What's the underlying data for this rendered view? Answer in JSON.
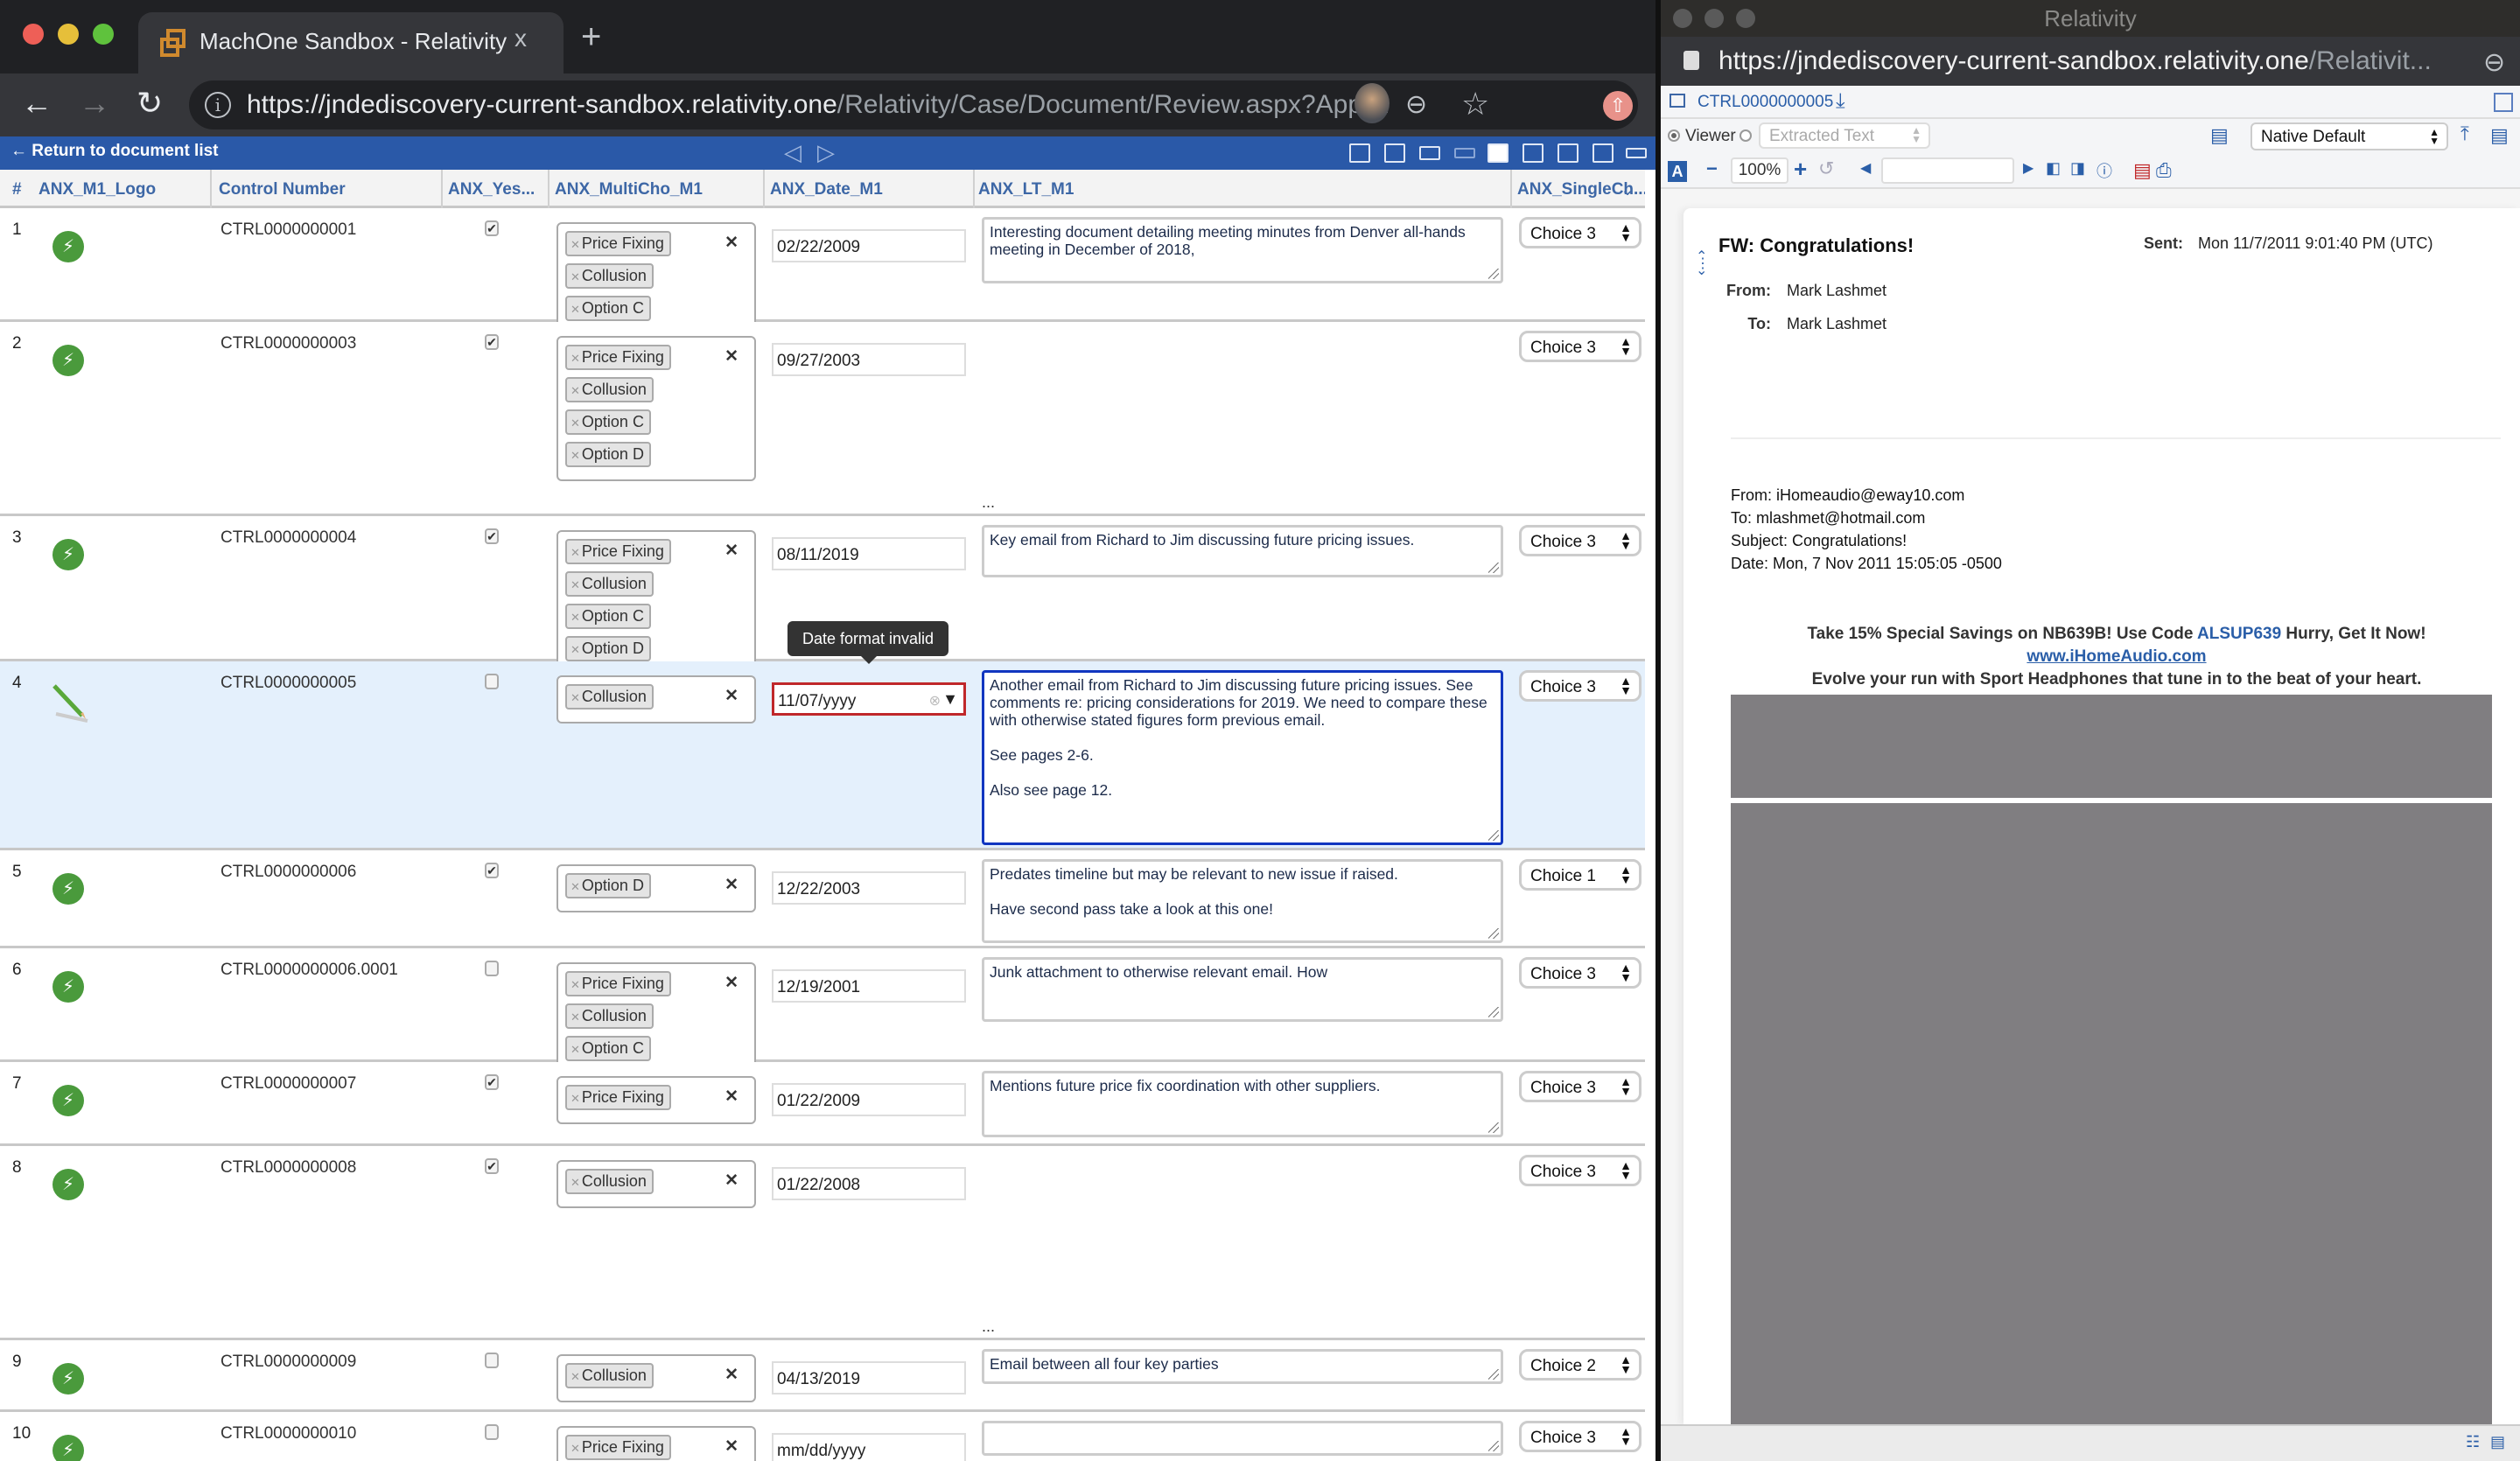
{
  "browser": {
    "tab_title": "MachOne Sandbox - Relativity",
    "tab_close": "x",
    "new_tab": "+",
    "url_host": "https://jndediscovery-current-sandbox.relativity.one",
    "url_path": "/Relativity/Case/Document/Review.aspx?Appl...",
    "back": "←",
    "forward": "→",
    "reload": "↻"
  },
  "review_bar": {
    "return_label": "← Return to document list",
    "prev": "◁",
    "next": "▷",
    "icons": [
      "print-icon",
      "print-alt-icon",
      "keyboard-info-icon",
      "keyboard-icon",
      "grid-layout-icon",
      "popout-icon",
      "panel-layout-icon",
      "window-settings-icon",
      "collapse-icon"
    ]
  },
  "grid": {
    "columns": [
      "#",
      "ANX_M1_Logo",
      "Control Number",
      "ANX_Yes...",
      "ANX_MultiCho_M1",
      "ANX_Date_M1",
      "ANX_LT_M1",
      "ANX_SingleCh..."
    ],
    "tooltip": "Date format invalid",
    "rows": [
      {
        "n": "1",
        "logo": "bolt",
        "control": "CTRL0000000001",
        "checked": true,
        "multi": [
          "Price Fixing",
          "Collusion",
          "Option C"
        ],
        "date": "02/22/2009",
        "text": "Interesting document detailing meeting minutes from Denver all-hands meeting in December of 2018,",
        "choice": "Choice 3"
      },
      {
        "n": "2",
        "logo": "bolt",
        "control": "CTRL0000000003",
        "checked": true,
        "multi": [
          "Price Fixing",
          "Collusion",
          "Option C",
          "Option D"
        ],
        "date": "09/27/2003",
        "text": null,
        "choice": "Choice 3",
        "ellipsis": "..."
      },
      {
        "n": "3",
        "logo": "bolt",
        "control": "CTRL0000000004",
        "checked": true,
        "multi": [
          "Price Fixing",
          "Collusion",
          "Option C",
          "Option D"
        ],
        "date": "08/11/2019",
        "text": "Key email from Richard to Jim discussing future pricing issues.",
        "choice": "Choice 3"
      },
      {
        "n": "4",
        "logo": "pencil",
        "control": "CTRL0000000005",
        "checked": false,
        "multi": [
          "Collusion"
        ],
        "date": "11/07/yyyy",
        "date_invalid": true,
        "text": "Another email from Richard to Jim discussing future pricing issues. See comments re: pricing considerations for 2019. We need to compare these with otherwise stated figures form previous email.\n\nSee pages 2-6.\n\nAlso see page 12.",
        "choice": "Choice 3"
      },
      {
        "n": "5",
        "logo": "bolt",
        "control": "CTRL0000000006",
        "checked": true,
        "multi": [
          "Option D"
        ],
        "date": "12/22/2003",
        "text": "Predates timeline but may be relevant to new issue if raised.\n\nHave second pass take a look at this one!",
        "choice": "Choice 1"
      },
      {
        "n": "6",
        "logo": "bolt",
        "control": "CTRL0000000006.0001",
        "checked": false,
        "multi": [
          "Price Fixing",
          "Collusion",
          "Option C"
        ],
        "date": "12/19/2001",
        "text": "Junk attachment to otherwise relevant email. How",
        "choice": "Choice 3"
      },
      {
        "n": "7",
        "logo": "bolt",
        "control": "CTRL0000000007",
        "checked": true,
        "multi": [
          "Price Fixing"
        ],
        "date": "01/22/2009",
        "text": "Mentions future price fix coordination with other suppliers.",
        "choice": "Choice 3"
      },
      {
        "n": "8",
        "logo": "bolt",
        "control": "CTRL0000000008",
        "checked": true,
        "multi": [
          "Collusion"
        ],
        "date": "01/22/2008",
        "text": null,
        "choice": "Choice 3",
        "ellipsis": "..."
      },
      {
        "n": "9",
        "logo": "bolt",
        "control": "CTRL0000000009",
        "checked": false,
        "multi": [
          "Collusion"
        ],
        "date": "04/13/2019",
        "text": "Email between all four key parties",
        "choice": "Choice 2"
      },
      {
        "n": "10",
        "logo": "bolt",
        "control": "CTRL0000000010",
        "checked": false,
        "multi": [
          "Price Fixing"
        ],
        "date": "mm/dd/yyyy",
        "text": "",
        "choice": "Choice 3"
      }
    ]
  },
  "viewer": {
    "window_title": "Relativity",
    "url_host": "https://jndediscovery-current-sandbox.relativity.one",
    "url_path": "/Relativit...",
    "doc_id": "CTRL0000000005",
    "viewer_label": "Viewer",
    "extracted_text_placeholder": "Extracted Text",
    "native_select": "Native Default",
    "zoom_level": "100%",
    "email": {
      "subject": "FW: Congratulations!",
      "sent_label": "Sent:",
      "sent": "Mon 11/7/2011 9:01:40 PM (UTC)",
      "from_label": "From:",
      "from": "Mark Lashmet",
      "to_label": "To:",
      "to": "Mark Lashmet",
      "body_from": "From: iHomeaudio@eway10.com",
      "body_to": "To: mlashmet@hotmail.com",
      "body_subject": "Subject: Congratulations!",
      "body_date": "Date: Mon, 7 Nov 2011 15:05:05 -0500",
      "promo_pre": "Take 15% Special Savings on NB639B! Use Code ",
      "promo_code": "ALSUP639",
      "promo_post": " Hurry, Get It Now!",
      "promo_link": "www.iHomeAudio.com",
      "promo_tagline": "Evolve your run with Sport Headphones that tune in to the beat of your heart."
    }
  },
  "colors": {
    "accent_blue": "#2a59a8",
    "header_text": "#3d67a6",
    "logo_green": "#4a9a3c",
    "error_red": "#c0282a",
    "active_row": "#e4f0fc"
  }
}
